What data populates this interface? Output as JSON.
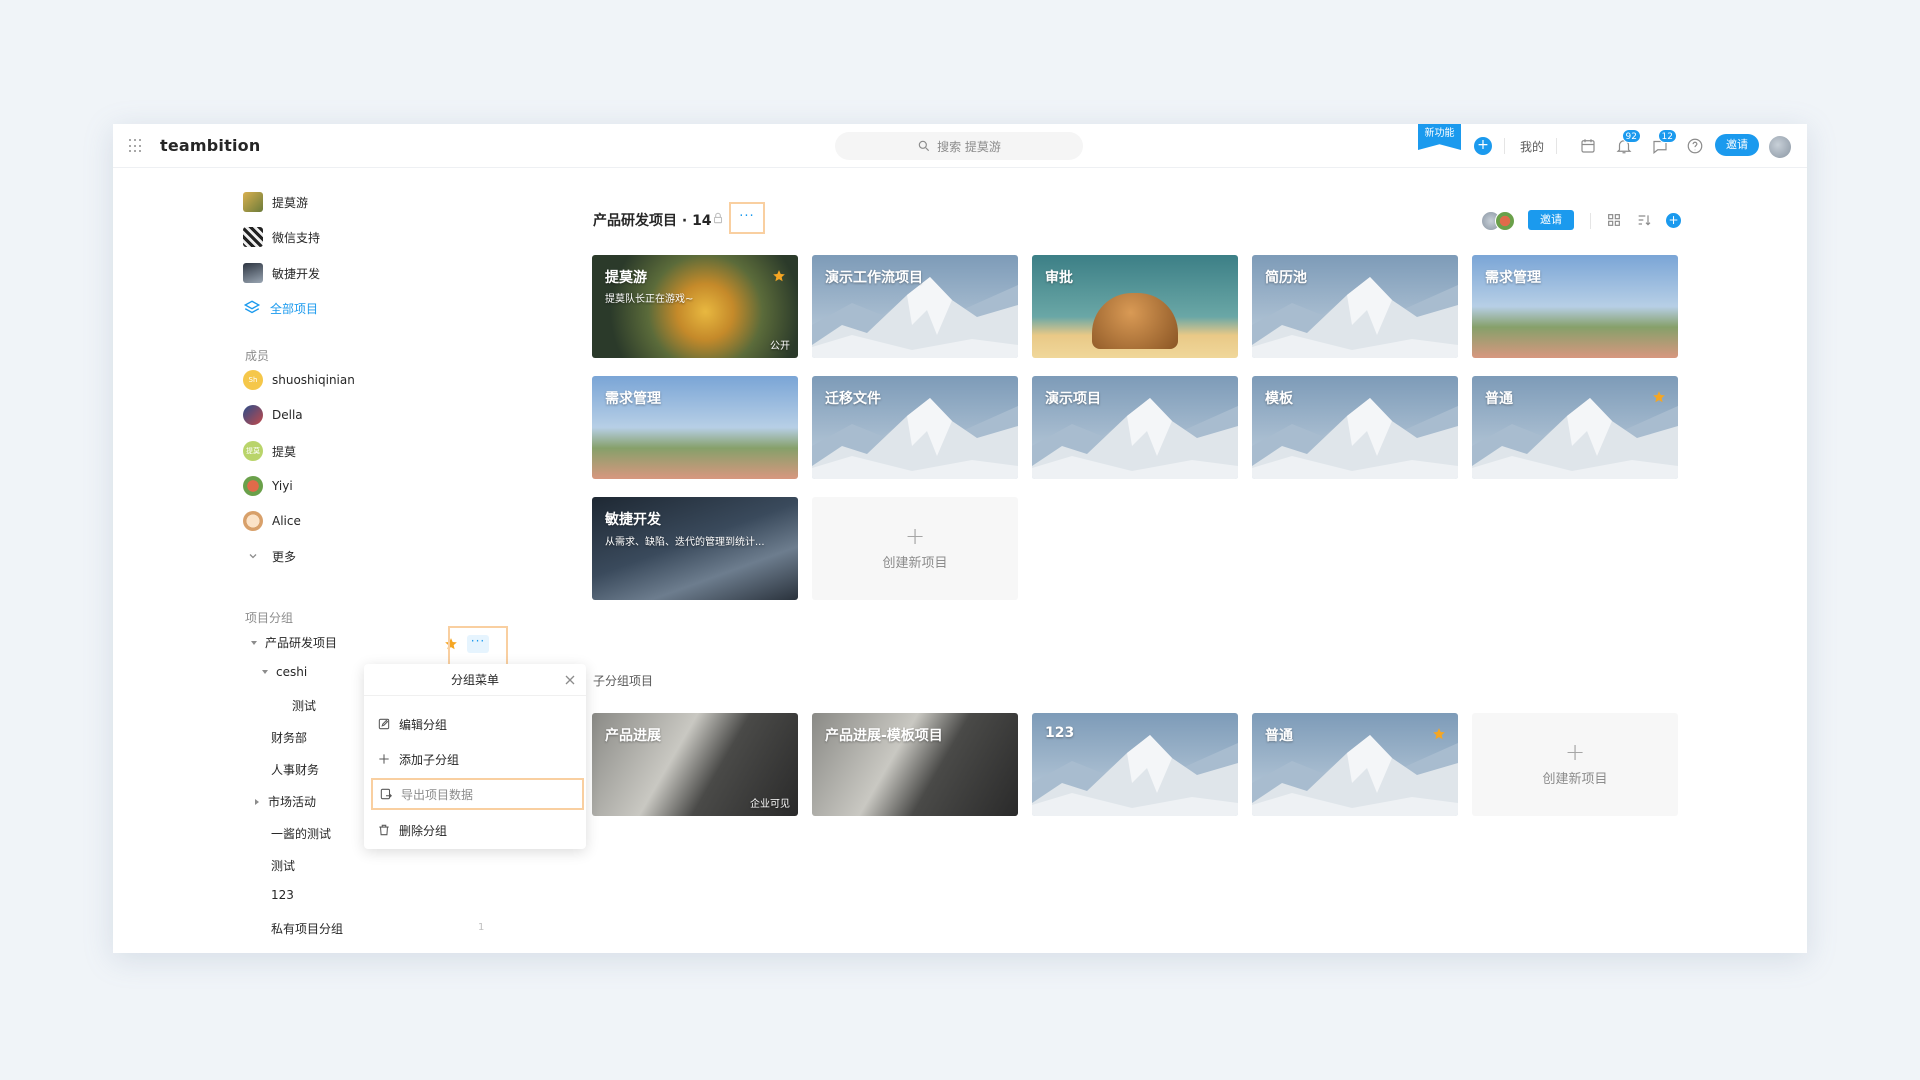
{
  "header": {
    "logo": "teambition",
    "search_placeholder": "搜索 提莫游",
    "new_feature": "新功能",
    "mine": "我的",
    "notif_badge": "92",
    "msg_badge": "12",
    "invite": "邀请"
  },
  "sidebar": {
    "projects": [
      {
        "label": "提莫游",
        "color": "#c9a44a"
      },
      {
        "label": "微信支持",
        "color": "#444444"
      },
      {
        "label": "敏捷开发",
        "color": "#5b6675"
      }
    ],
    "all_projects": "全部项目",
    "members_title": "成员",
    "members": [
      {
        "name": "shuoshiqinian",
        "color": "#f5c74a",
        "initials": "Sh"
      },
      {
        "name": "Della",
        "color": "#7a4a6a",
        "initials": ""
      },
      {
        "name": "提莫",
        "color": "#b9d46a",
        "initials": "提莫"
      },
      {
        "name": "Yiyi",
        "color": "#e06a4a",
        "initials": ""
      },
      {
        "name": "Alice",
        "color": "#f3c69a",
        "initials": ""
      }
    ],
    "more": "更多",
    "groups_title": "项目分组",
    "groups": {
      "product": "产品研发项目",
      "ceshi": "ceshi",
      "test_child": "测试",
      "finance": "财务部",
      "hr": "人事财务",
      "market": "市场活动",
      "yijiang": "一酱的测试",
      "test": "测试",
      "num": "123",
      "private": "私有项目分组",
      "private_count": "1"
    }
  },
  "menu": {
    "title": "分组菜单",
    "items": [
      "编辑分组",
      "添加子分组",
      "导出项目数据",
      "删除分组"
    ]
  },
  "main": {
    "title": "产品研发项目 · 14",
    "more": "···",
    "invite": "邀请",
    "cards": [
      {
        "name": "提莫游",
        "desc": "提莫队长正在游戏~",
        "tag": "公开",
        "star": true
      },
      {
        "name": "演示工作流项目"
      },
      {
        "name": "审批"
      },
      {
        "name": "简历池"
      },
      {
        "name": "需求管理"
      },
      {
        "name": "需求管理"
      },
      {
        "name": "迁移文件"
      },
      {
        "name": "演示项目"
      },
      {
        "name": "模板"
      },
      {
        "name": "普通",
        "star": true
      },
      {
        "name": "敏捷开发",
        "desc": "从需求、缺陷、迭代的管理到统计..."
      }
    ],
    "create_new": "创建新项目",
    "sub_title": "子分组项目",
    "sub_cards": [
      {
        "name": "产品进展",
        "tag": "企业可见"
      },
      {
        "name": "产品进展-模板项目"
      },
      {
        "name": "123"
      },
      {
        "name": "普通",
        "star": true
      }
    ]
  },
  "colors": {
    "accent": "#1b9aee",
    "star": "#f5a623",
    "highlight": "#f9cfa0"
  }
}
